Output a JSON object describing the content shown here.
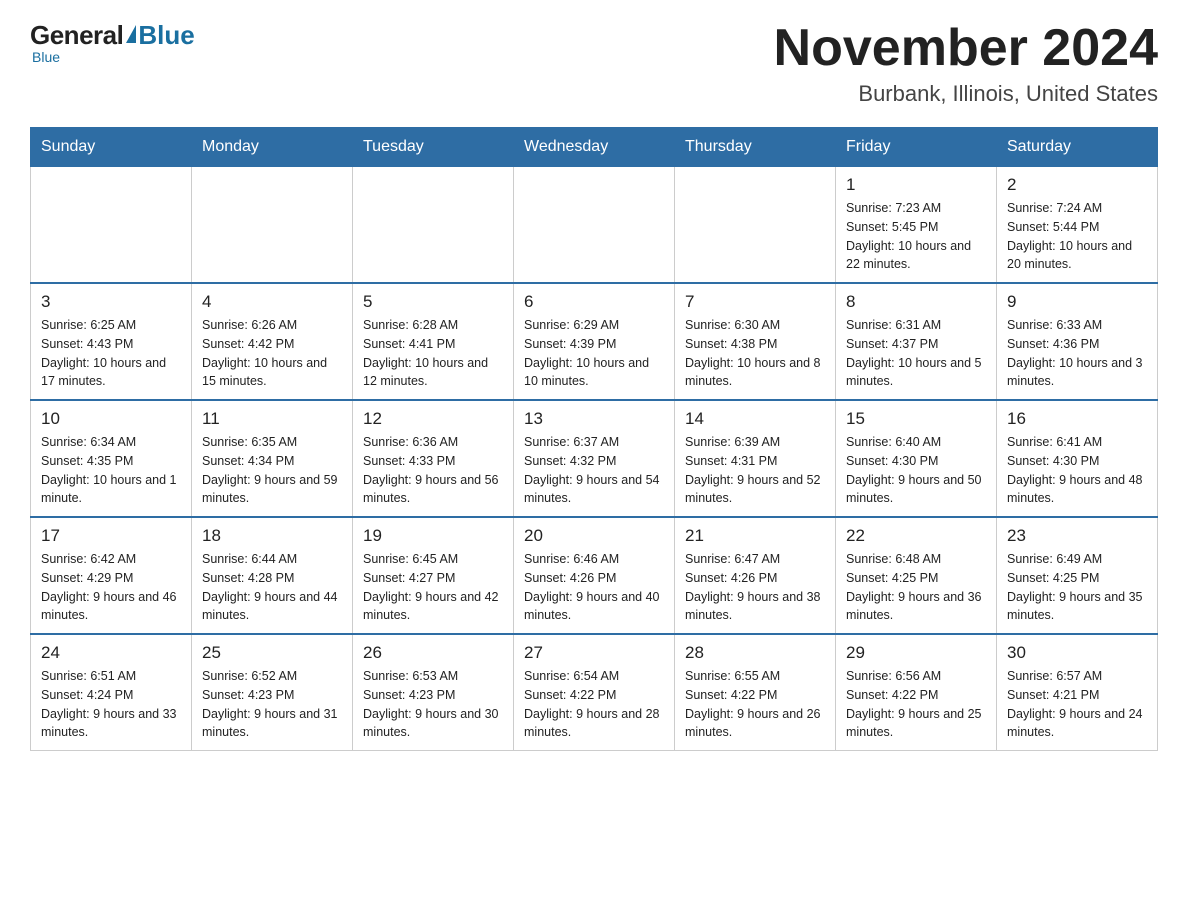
{
  "header": {
    "logo_general": "General",
    "logo_blue": "Blue",
    "month_title": "November 2024",
    "location": "Burbank, Illinois, United States"
  },
  "days_of_week": [
    "Sunday",
    "Monday",
    "Tuesday",
    "Wednesday",
    "Thursday",
    "Friday",
    "Saturday"
  ],
  "weeks": [
    [
      {
        "day": "",
        "sunrise": "",
        "sunset": "",
        "daylight": ""
      },
      {
        "day": "",
        "sunrise": "",
        "sunset": "",
        "daylight": ""
      },
      {
        "day": "",
        "sunrise": "",
        "sunset": "",
        "daylight": ""
      },
      {
        "day": "",
        "sunrise": "",
        "sunset": "",
        "daylight": ""
      },
      {
        "day": "",
        "sunrise": "",
        "sunset": "",
        "daylight": ""
      },
      {
        "day": "1",
        "sunrise": "Sunrise: 7:23 AM",
        "sunset": "Sunset: 5:45 PM",
        "daylight": "Daylight: 10 hours and 22 minutes."
      },
      {
        "day": "2",
        "sunrise": "Sunrise: 7:24 AM",
        "sunset": "Sunset: 5:44 PM",
        "daylight": "Daylight: 10 hours and 20 minutes."
      }
    ],
    [
      {
        "day": "3",
        "sunrise": "Sunrise: 6:25 AM",
        "sunset": "Sunset: 4:43 PM",
        "daylight": "Daylight: 10 hours and 17 minutes."
      },
      {
        "day": "4",
        "sunrise": "Sunrise: 6:26 AM",
        "sunset": "Sunset: 4:42 PM",
        "daylight": "Daylight: 10 hours and 15 minutes."
      },
      {
        "day": "5",
        "sunrise": "Sunrise: 6:28 AM",
        "sunset": "Sunset: 4:41 PM",
        "daylight": "Daylight: 10 hours and 12 minutes."
      },
      {
        "day": "6",
        "sunrise": "Sunrise: 6:29 AM",
        "sunset": "Sunset: 4:39 PM",
        "daylight": "Daylight: 10 hours and 10 minutes."
      },
      {
        "day": "7",
        "sunrise": "Sunrise: 6:30 AM",
        "sunset": "Sunset: 4:38 PM",
        "daylight": "Daylight: 10 hours and 8 minutes."
      },
      {
        "day": "8",
        "sunrise": "Sunrise: 6:31 AM",
        "sunset": "Sunset: 4:37 PM",
        "daylight": "Daylight: 10 hours and 5 minutes."
      },
      {
        "day": "9",
        "sunrise": "Sunrise: 6:33 AM",
        "sunset": "Sunset: 4:36 PM",
        "daylight": "Daylight: 10 hours and 3 minutes."
      }
    ],
    [
      {
        "day": "10",
        "sunrise": "Sunrise: 6:34 AM",
        "sunset": "Sunset: 4:35 PM",
        "daylight": "Daylight: 10 hours and 1 minute."
      },
      {
        "day": "11",
        "sunrise": "Sunrise: 6:35 AM",
        "sunset": "Sunset: 4:34 PM",
        "daylight": "Daylight: 9 hours and 59 minutes."
      },
      {
        "day": "12",
        "sunrise": "Sunrise: 6:36 AM",
        "sunset": "Sunset: 4:33 PM",
        "daylight": "Daylight: 9 hours and 56 minutes."
      },
      {
        "day": "13",
        "sunrise": "Sunrise: 6:37 AM",
        "sunset": "Sunset: 4:32 PM",
        "daylight": "Daylight: 9 hours and 54 minutes."
      },
      {
        "day": "14",
        "sunrise": "Sunrise: 6:39 AM",
        "sunset": "Sunset: 4:31 PM",
        "daylight": "Daylight: 9 hours and 52 minutes."
      },
      {
        "day": "15",
        "sunrise": "Sunrise: 6:40 AM",
        "sunset": "Sunset: 4:30 PM",
        "daylight": "Daylight: 9 hours and 50 minutes."
      },
      {
        "day": "16",
        "sunrise": "Sunrise: 6:41 AM",
        "sunset": "Sunset: 4:30 PM",
        "daylight": "Daylight: 9 hours and 48 minutes."
      }
    ],
    [
      {
        "day": "17",
        "sunrise": "Sunrise: 6:42 AM",
        "sunset": "Sunset: 4:29 PM",
        "daylight": "Daylight: 9 hours and 46 minutes."
      },
      {
        "day": "18",
        "sunrise": "Sunrise: 6:44 AM",
        "sunset": "Sunset: 4:28 PM",
        "daylight": "Daylight: 9 hours and 44 minutes."
      },
      {
        "day": "19",
        "sunrise": "Sunrise: 6:45 AM",
        "sunset": "Sunset: 4:27 PM",
        "daylight": "Daylight: 9 hours and 42 minutes."
      },
      {
        "day": "20",
        "sunrise": "Sunrise: 6:46 AM",
        "sunset": "Sunset: 4:26 PM",
        "daylight": "Daylight: 9 hours and 40 minutes."
      },
      {
        "day": "21",
        "sunrise": "Sunrise: 6:47 AM",
        "sunset": "Sunset: 4:26 PM",
        "daylight": "Daylight: 9 hours and 38 minutes."
      },
      {
        "day": "22",
        "sunrise": "Sunrise: 6:48 AM",
        "sunset": "Sunset: 4:25 PM",
        "daylight": "Daylight: 9 hours and 36 minutes."
      },
      {
        "day": "23",
        "sunrise": "Sunrise: 6:49 AM",
        "sunset": "Sunset: 4:25 PM",
        "daylight": "Daylight: 9 hours and 35 minutes."
      }
    ],
    [
      {
        "day": "24",
        "sunrise": "Sunrise: 6:51 AM",
        "sunset": "Sunset: 4:24 PM",
        "daylight": "Daylight: 9 hours and 33 minutes."
      },
      {
        "day": "25",
        "sunrise": "Sunrise: 6:52 AM",
        "sunset": "Sunset: 4:23 PM",
        "daylight": "Daylight: 9 hours and 31 minutes."
      },
      {
        "day": "26",
        "sunrise": "Sunrise: 6:53 AM",
        "sunset": "Sunset: 4:23 PM",
        "daylight": "Daylight: 9 hours and 30 minutes."
      },
      {
        "day": "27",
        "sunrise": "Sunrise: 6:54 AM",
        "sunset": "Sunset: 4:22 PM",
        "daylight": "Daylight: 9 hours and 28 minutes."
      },
      {
        "day": "28",
        "sunrise": "Sunrise: 6:55 AM",
        "sunset": "Sunset: 4:22 PM",
        "daylight": "Daylight: 9 hours and 26 minutes."
      },
      {
        "day": "29",
        "sunrise": "Sunrise: 6:56 AM",
        "sunset": "Sunset: 4:22 PM",
        "daylight": "Daylight: 9 hours and 25 minutes."
      },
      {
        "day": "30",
        "sunrise": "Sunrise: 6:57 AM",
        "sunset": "Sunset: 4:21 PM",
        "daylight": "Daylight: 9 hours and 24 minutes."
      }
    ]
  ]
}
